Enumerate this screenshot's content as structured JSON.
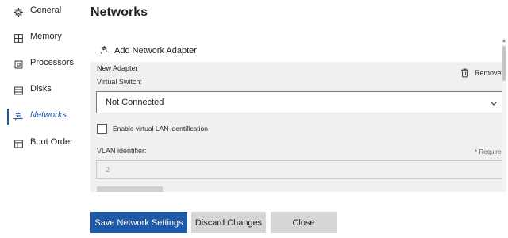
{
  "sidebar": {
    "items": [
      {
        "label": "General",
        "icon": "gear-icon",
        "active": false
      },
      {
        "label": "Memory",
        "icon": "memory-icon",
        "active": false
      },
      {
        "label": "Processors",
        "icon": "processor-icon",
        "active": false
      },
      {
        "label": "Disks",
        "icon": "disk-icon",
        "active": false
      },
      {
        "label": "Networks",
        "icon": "network-icon",
        "active": true
      },
      {
        "label": "Boot Order",
        "icon": "boot-order-icon",
        "active": false
      }
    ],
    "accent_color": "#1e56a3"
  },
  "main": {
    "title": "Networks",
    "add_adapter_label": "Add Network Adapter",
    "adapter": {
      "name": "New Adapter",
      "remove_label": "Remove",
      "virtual_switch_label": "Virtual Switch:",
      "virtual_switch_value": "Not Connected",
      "vlan_checkbox_label": "Enable virtual LAN identification",
      "vlan_checkbox_checked": false,
      "vlan_identifier_label": "VLAN identifier:",
      "required_label": "* Required",
      "vlan_identifier_value": "2"
    }
  },
  "footer": {
    "save_label": "Save Network Settings",
    "discard_label": "Discard Changes",
    "close_label": "Close"
  },
  "colors": {
    "primary_button": "#1e5aa8",
    "secondary_button": "#d6d6d6",
    "panel_background": "#f0f0f0"
  }
}
